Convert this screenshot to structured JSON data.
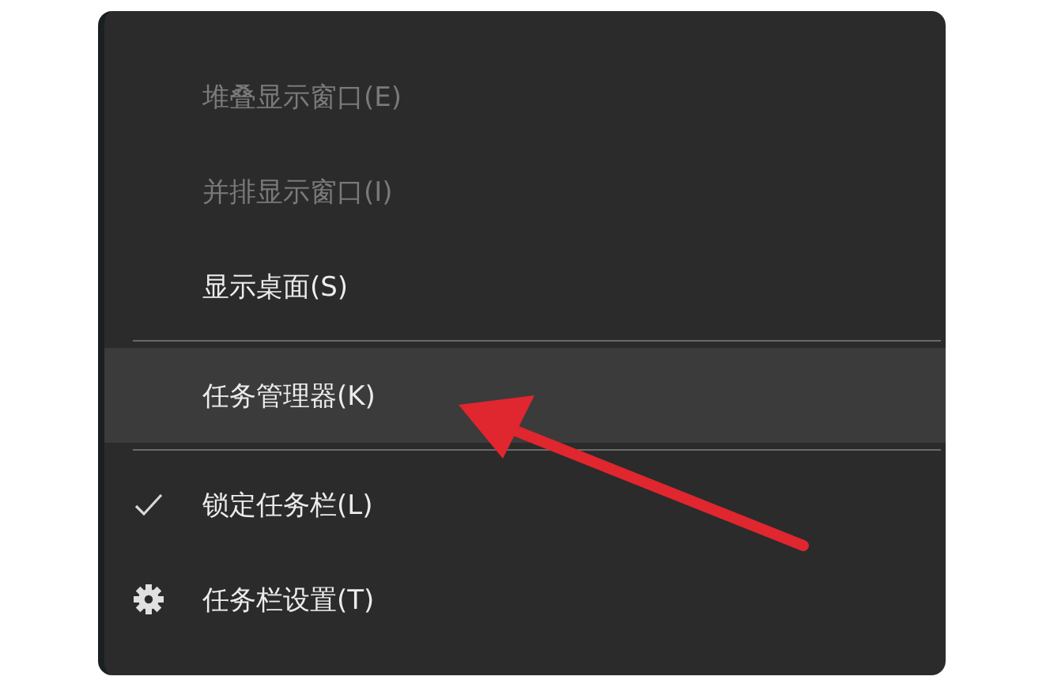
{
  "context_menu": {
    "items": [
      {
        "kind": "item",
        "label": "堆叠显示窗口(E)",
        "disabled": true,
        "selected": false
      },
      {
        "kind": "item",
        "label": "并排显示窗口(I)",
        "disabled": true,
        "selected": false
      },
      {
        "kind": "item",
        "label": "显示桌面(S)",
        "disabled": false,
        "selected": false
      },
      {
        "kind": "separator"
      },
      {
        "kind": "item",
        "label": "任务管理器(K)",
        "disabled": false,
        "selected": true
      },
      {
        "kind": "separator"
      },
      {
        "kind": "check-item",
        "label": "锁定任务栏(L)",
        "disabled": false,
        "selected": false,
        "checked": true
      },
      {
        "kind": "gear-item",
        "label": "任务栏设置(T)",
        "disabled": false,
        "selected": false
      }
    ]
  },
  "annotation": {
    "kind": "arrow"
  }
}
